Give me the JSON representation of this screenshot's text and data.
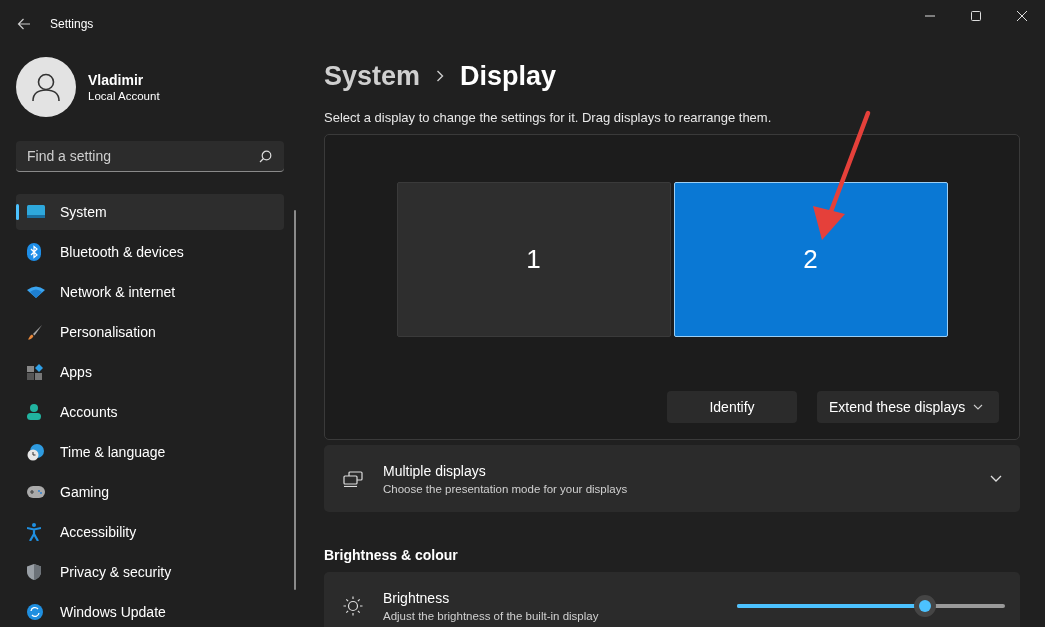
{
  "window": {
    "title": "Settings"
  },
  "profile": {
    "name": "Vladimir",
    "account": "Local Account"
  },
  "search": {
    "placeholder": "Find a setting"
  },
  "sidebar": {
    "items": [
      {
        "label": "System",
        "selected": true
      },
      {
        "label": "Bluetooth & devices",
        "selected": false
      },
      {
        "label": "Network & internet",
        "selected": false
      },
      {
        "label": "Personalisation",
        "selected": false
      },
      {
        "label": "Apps",
        "selected": false
      },
      {
        "label": "Accounts",
        "selected": false
      },
      {
        "label": "Time & language",
        "selected": false
      },
      {
        "label": "Gaming",
        "selected": false
      },
      {
        "label": "Accessibility",
        "selected": false
      },
      {
        "label": "Privacy & security",
        "selected": false
      },
      {
        "label": "Windows Update",
        "selected": false
      }
    ]
  },
  "breadcrumb": {
    "parent": "System",
    "current": "Display"
  },
  "description": "Select a display to change the settings for it. Drag displays to rearrange them.",
  "displays": [
    {
      "label": "1",
      "selected": false
    },
    {
      "label": "2",
      "selected": true
    }
  ],
  "identify_button": "Identify",
  "mode_dropdown": {
    "value": "Extend these displays"
  },
  "multiple_displays": {
    "title": "Multiple displays",
    "subtitle": "Choose the presentation mode for your displays",
    "expanded": false
  },
  "section_heading": "Brightness & colour",
  "brightness": {
    "title": "Brightness",
    "subtitle": "Adjust the brightness of the built-in display",
    "level": 0.7
  }
}
